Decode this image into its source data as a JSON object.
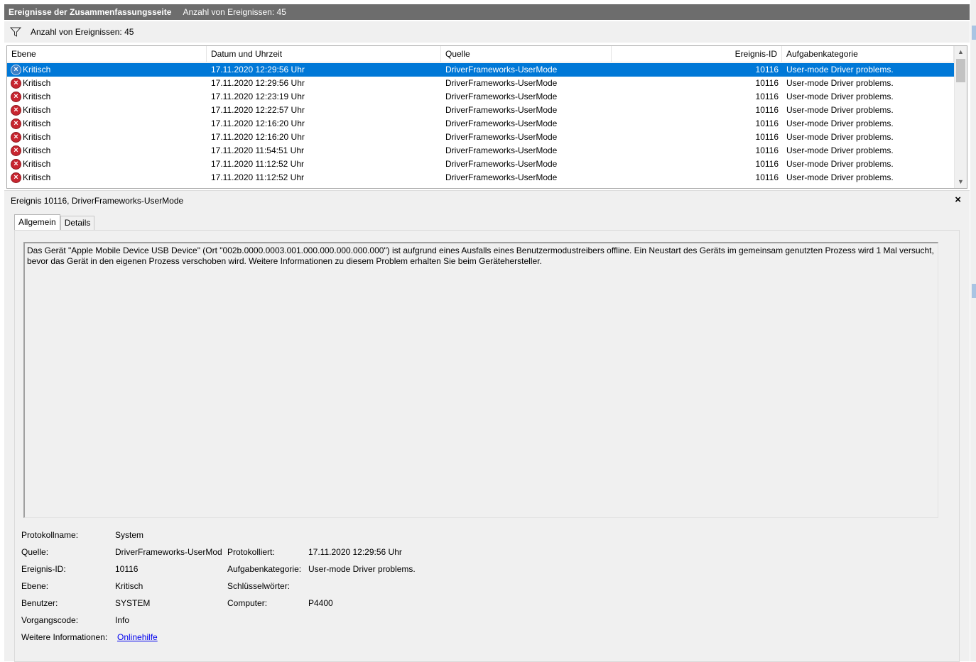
{
  "title": {
    "main": "Ereignisse der Zusammenfassungsseite",
    "count": "Anzahl von Ereignissen: 45"
  },
  "filter": {
    "icon": "funnel-icon",
    "text": "Anzahl von Ereignissen: 45"
  },
  "columns": {
    "level": "Ebene",
    "date": "Datum und Uhrzeit",
    "source": "Quelle",
    "id": "Ereignis-ID",
    "category": "Aufgabenkategorie"
  },
  "rows": [
    {
      "level": "Kritisch",
      "date": "17.11.2020 12:29:56 Uhr",
      "source": "DriverFrameworks-UserMode",
      "id": "10116",
      "category": "User-mode Driver problems."
    },
    {
      "level": "Kritisch",
      "date": "17.11.2020 12:29:56 Uhr",
      "source": "DriverFrameworks-UserMode",
      "id": "10116",
      "category": "User-mode Driver problems."
    },
    {
      "level": "Kritisch",
      "date": "17.11.2020 12:23:19 Uhr",
      "source": "DriverFrameworks-UserMode",
      "id": "10116",
      "category": "User-mode Driver problems."
    },
    {
      "level": "Kritisch",
      "date": "17.11.2020 12:22:57 Uhr",
      "source": "DriverFrameworks-UserMode",
      "id": "10116",
      "category": "User-mode Driver problems."
    },
    {
      "level": "Kritisch",
      "date": "17.11.2020 12:16:20 Uhr",
      "source": "DriverFrameworks-UserMode",
      "id": "10116",
      "category": "User-mode Driver problems."
    },
    {
      "level": "Kritisch",
      "date": "17.11.2020 12:16:20 Uhr",
      "source": "DriverFrameworks-UserMode",
      "id": "10116",
      "category": "User-mode Driver problems."
    },
    {
      "level": "Kritisch",
      "date": "17.11.2020 11:54:51 Uhr",
      "source": "DriverFrameworks-UserMode",
      "id": "10116",
      "category": "User-mode Driver problems."
    },
    {
      "level": "Kritisch",
      "date": "17.11.2020 11:12:52 Uhr",
      "source": "DriverFrameworks-UserMode",
      "id": "10116",
      "category": "User-mode Driver problems."
    },
    {
      "level": "Kritisch",
      "date": "17.11.2020 11:12:52 Uhr",
      "source": "DriverFrameworks-UserMode",
      "id": "10116",
      "category": "User-mode Driver problems."
    }
  ],
  "selected_row": 0,
  "detail": {
    "title": "Ereignis 10116, DriverFrameworks-UserMode",
    "close": "×",
    "tabs": [
      "Allgemein",
      "Details"
    ],
    "active_tab": "Allgemein",
    "description": "Das Gerät \"Apple Mobile Device USB Device\" (Ort \"002b.0000.0003.001.000.000.000.000.000\") ist aufgrund eines Ausfalls eines Benutzermodustreibers offline. Ein Neustart des Geräts im gemeinsam genutzten Prozess wird 1 Mal versucht, bevor das Gerät in den eigenen Prozess verschoben wird.  Weitere Informationen zu diesem Problem erhalten Sie beim Gerätehersteller.",
    "fields": {
      "log_label": "Protokollname:",
      "log": "System",
      "source_label": "Quelle:",
      "source": "DriverFrameworks-UserMod",
      "logged_label": "Protokolliert:",
      "logged": "17.11.2020 12:29:56 Uhr",
      "id_label": "Ereignis-ID:",
      "id": "10116",
      "category_label": "Aufgabenkategorie:",
      "category": "User-mode Driver problems.",
      "level_label": "Ebene:",
      "level": "Kritisch",
      "keywords_label": "Schlüsselwörter:",
      "keywords": "",
      "user_label": "Benutzer:",
      "user": "SYSTEM",
      "computer_label": "Computer:",
      "computer": "P4400",
      "opcode_label": "Vorgangscode:",
      "opcode": "Info",
      "moreinfo_label": "Weitere Informationen:",
      "moreinfo_link": "Onlinehilfe"
    }
  },
  "colors": {
    "title_bg": "#6d6d6d",
    "selection": "#0078d7",
    "critical_icon": "#c82630",
    "link": "#0000ee"
  }
}
